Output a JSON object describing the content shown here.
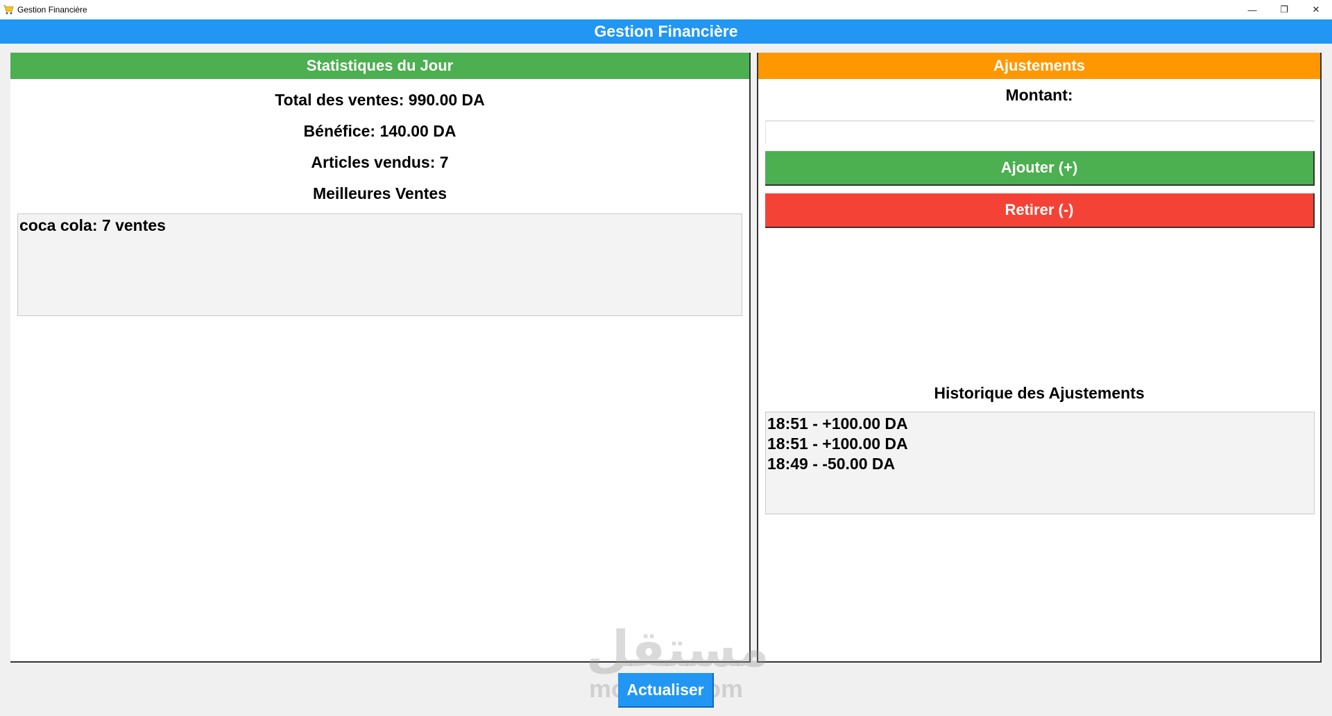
{
  "window": {
    "title": "Gestion Financière",
    "controls": {
      "minimize": "—",
      "maximize": "❐",
      "close": "✕"
    }
  },
  "header": {
    "title": "Gestion Financière"
  },
  "stats_panel": {
    "title": "Statistiques du Jour",
    "total_sales": "Total des ventes: 990.00 DA",
    "profit": "Bénéfice: 140.00 DA",
    "items_sold": "Articles vendus: 7",
    "best_sales_title": "Meilleures Ventes",
    "best_sales": [
      "coca cola: 7 ventes"
    ]
  },
  "adjust_panel": {
    "title": "Ajustements",
    "amount_label": "Montant:",
    "amount_value": "",
    "add_button": "Ajouter (+)",
    "remove_button": "Retirer (-)",
    "history_title": "Historique des Ajustements",
    "history": [
      "18:51 - +100.00 DA",
      "18:51 - +100.00 DA",
      "18:49 - -50.00 DA"
    ]
  },
  "footer": {
    "refresh_button": "Actualiser"
  },
  "watermark": {
    "arabic": "مستقل",
    "latin": "mostaql.com"
  },
  "colors": {
    "header": "#2196f3",
    "stats_head": "#4caf50",
    "adjust_head": "#ff9800",
    "add": "#4caf50",
    "remove": "#f44336"
  },
  "icons": {
    "app": "shopping-cart-icon"
  }
}
